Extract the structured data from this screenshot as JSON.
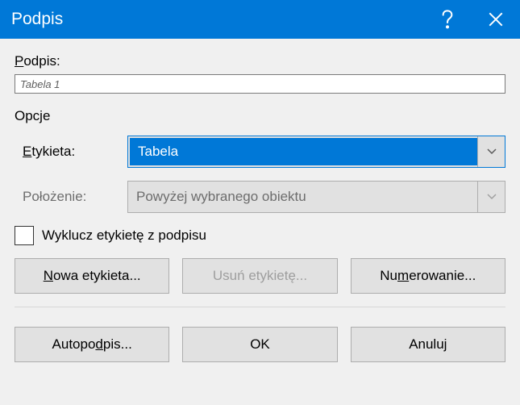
{
  "titlebar": {
    "title": "Podpis"
  },
  "caption": {
    "label_pre": "P",
    "label_rest": "odpis:",
    "value": "Tabela 1"
  },
  "options": {
    "group_label": "Opcje",
    "etykieta": {
      "label_pre": "E",
      "label_rest": "tykieta:",
      "value": "Tabela"
    },
    "polozenie": {
      "label": "Położenie:",
      "value": "Powyżej wybranego obiektu"
    },
    "exclude_checkbox": "Wyklucz etykietę z podpisu"
  },
  "buttons": {
    "new_label_pre": "N",
    "new_label_rest": "owa etykieta...",
    "delete_label": "Usuń etykietę...",
    "numbering_pre": "Nu",
    "numbering_u": "m",
    "numbering_rest": "erowanie...",
    "autocaption_pre": "Autopo",
    "autocaption_u": "d",
    "autocaption_rest": "pis...",
    "ok": "OK",
    "cancel": "Anuluj"
  }
}
